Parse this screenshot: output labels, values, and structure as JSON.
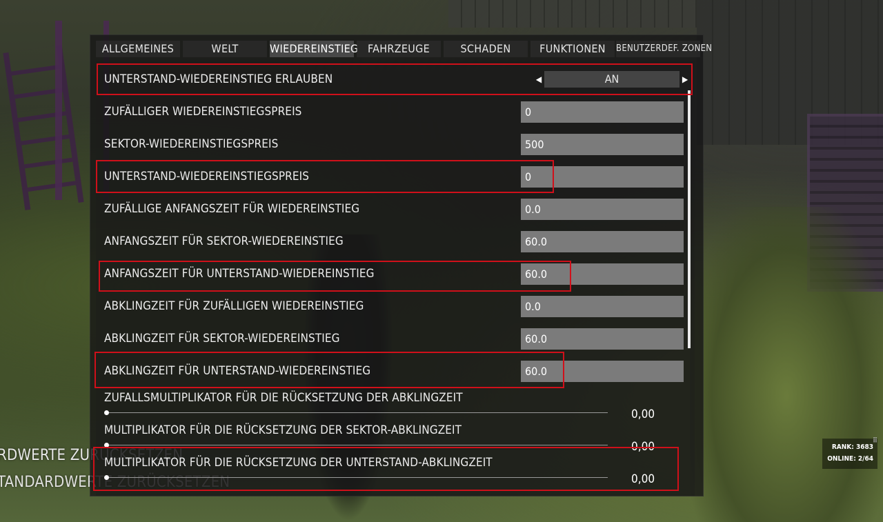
{
  "tabs": [
    {
      "label": "ALLGEMEINES"
    },
    {
      "label": "WELT"
    },
    {
      "label": "WIEDEREINSTIEG"
    },
    {
      "label": "FAHRZEUGE"
    },
    {
      "label": "SCHADEN"
    },
    {
      "label": "FUNKTIONEN"
    },
    {
      "label": "BENUTZERDEF. ZONEN"
    }
  ],
  "active_tab": "WIEDEREINSTIEG",
  "settings": {
    "toggle": {
      "label": "UNTERSTAND-WIEDEREINSTIEG ERLAUBEN",
      "value": "AN"
    },
    "fields": [
      {
        "label": "ZUFÄLLIGER WIEDEREINSTIEGSPREIS",
        "value": "0"
      },
      {
        "label": "SEKTOR-WIEDEREINSTIEGSPREIS",
        "value": "500"
      },
      {
        "label": "UNTERSTAND-WIEDEREINSTIEGSPREIS",
        "value": "0"
      },
      {
        "label": "ZUFÄLLIGE ANFANGSZEIT FÜR WIEDEREINSTIEG",
        "value": "0.0"
      },
      {
        "label": "ANFANGSZEIT FÜR SEKTOR-WIEDEREINSTIEG",
        "value": "60.0"
      },
      {
        "label": "ANFANGSZEIT FÜR UNTERSTAND-WIEDEREINSTIEG",
        "value": "60.0"
      },
      {
        "label": "ABKLINGZEIT FÜR ZUFÄLLIGEN WIEDEREINSTIEG",
        "value": "0.0"
      },
      {
        "label": "ABKLINGZEIT FÜR SEKTOR-WIEDEREINSTIEG",
        "value": "60.0"
      },
      {
        "label": "ABKLINGZEIT FÜR UNTERSTAND-WIEDEREINSTIEG",
        "value": "60.0"
      }
    ],
    "sliders": [
      {
        "label": "ZUFALLSMULTIPLIKATOR FÜR DIE RÜCKSETZUNG DER ABKLINGZEIT",
        "value": "0,00",
        "level": 0
      },
      {
        "label": "MULTIPLIKATOR FÜR DIE RÜCKSETZUNG DER SEKTOR-ABKLINGZEIT",
        "value": "0,00",
        "level": 0
      },
      {
        "label": "MULTIPLIKATOR FÜR DIE RÜCKSETZUNG DER UNTERSTAND-ABKLINGZEIT",
        "value": "0,00",
        "level": 0
      }
    ]
  },
  "hud": {
    "reset_1": "RDWERTE ZURÜCKSETZEN",
    "reset_2": "TANDARDWERTE ZURÜCKSETZEN",
    "rank": "RANK: 3683",
    "online": "ONLINE: 2/64"
  },
  "colors": {
    "highlight": "#d0101a",
    "field_bg": "#7b7b7b",
    "panel_bg": "#161616"
  }
}
